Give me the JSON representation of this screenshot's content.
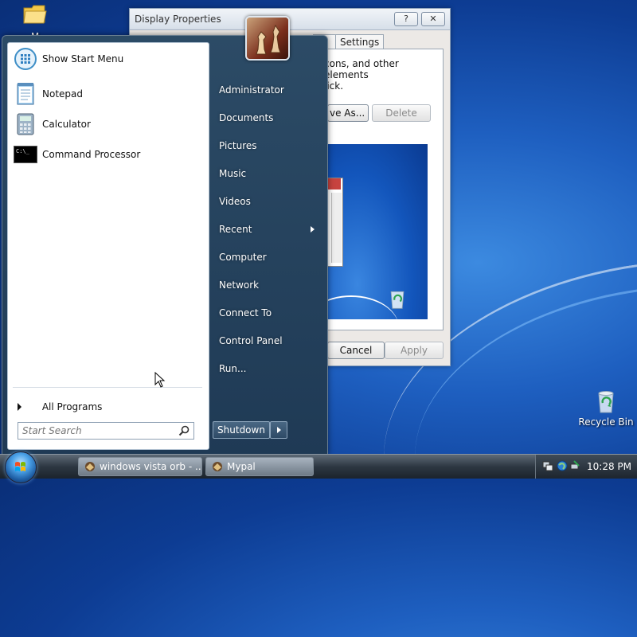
{
  "desktop": {
    "my_icon_label": "M",
    "recycle_bin_label": "Recycle Bin"
  },
  "display_window": {
    "title": "Display Properties",
    "help_label": "?",
    "close_label": "✕",
    "tab_partial": "e",
    "tab_settings": "Settings",
    "desc_line1": "cons, and other elements",
    "desc_line2": "lick.",
    "save_as_label": "ve As...",
    "delete_label": "Delete",
    "cancel_label": "Cancel",
    "apply_label": "Apply"
  },
  "start_menu": {
    "pinned": [
      {
        "label": "Show Start Menu",
        "icon": "show-start-menu-icon"
      },
      {
        "label": "Notepad",
        "icon": "notepad-icon"
      },
      {
        "label": "Calculator",
        "icon": "calculator-icon"
      },
      {
        "label": "Command Processor",
        "icon": "command-prompt-icon"
      }
    ],
    "all_programs": "All Programs",
    "search_placeholder": "Start Search",
    "right_items": [
      {
        "label": "Administrator"
      },
      {
        "label": "Documents"
      },
      {
        "label": "Pictures"
      },
      {
        "label": "Music"
      },
      {
        "label": "Videos"
      },
      {
        "label": "Recent"
      },
      {
        "label": "Computer"
      },
      {
        "label": "Network"
      },
      {
        "label": "Connect To"
      },
      {
        "label": "Control Panel"
      },
      {
        "label": "Run..."
      }
    ],
    "shutdown_label": "Shutdown",
    "cmd_icon_text": "C:\\_"
  },
  "taskbar": {
    "tasks": [
      {
        "label": "windows vista orb - ..."
      },
      {
        "label": "Mypal"
      }
    ],
    "clock": "10:28 PM"
  }
}
